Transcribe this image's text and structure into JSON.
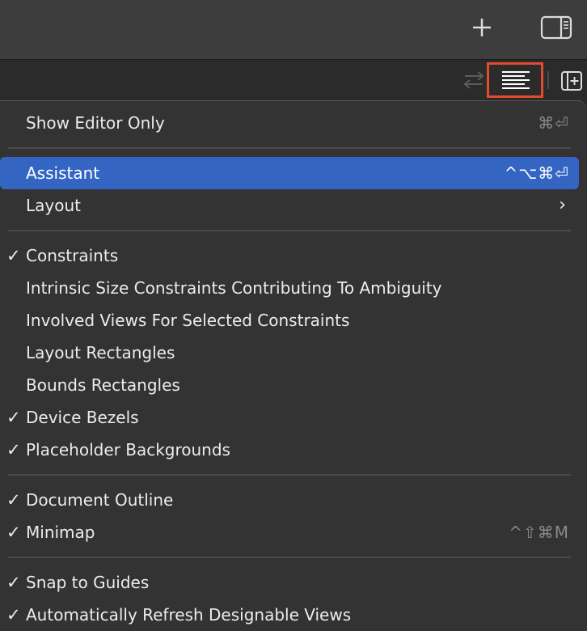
{
  "toolbar": {
    "plus_icon": "plus-icon",
    "inspector_icon": "inspector-toggle-icon"
  },
  "jumpbar": {
    "swap_icon": "swap-arrows-icon",
    "options_icon": "editor-options-icon",
    "add_editor_icon": "add-editor-icon",
    "highlight_color": "#e34b2c"
  },
  "menu": {
    "selected_color": "#3465c3",
    "items": [
      {
        "label": "Show Editor Only",
        "checked": false,
        "shortcut": "⌘⏎",
        "submenu": false
      },
      {
        "label": "Assistant",
        "checked": false,
        "shortcut": "^⌥⌘⏎",
        "submenu": false,
        "selected": true
      },
      {
        "label": "Layout",
        "checked": false,
        "shortcut": "",
        "submenu": true
      },
      {
        "label": "Constraints",
        "checked": true,
        "shortcut": "",
        "submenu": false
      },
      {
        "label": "Intrinsic Size Constraints Contributing To Ambiguity",
        "checked": false,
        "shortcut": "",
        "submenu": false
      },
      {
        "label": "Involved Views For Selected Constraints",
        "checked": false,
        "shortcut": "",
        "submenu": false
      },
      {
        "label": "Layout Rectangles",
        "checked": false,
        "shortcut": "",
        "submenu": false
      },
      {
        "label": "Bounds Rectangles",
        "checked": false,
        "shortcut": "",
        "submenu": false
      },
      {
        "label": "Device Bezels",
        "checked": true,
        "shortcut": "",
        "submenu": false
      },
      {
        "label": "Placeholder Backgrounds",
        "checked": true,
        "shortcut": "",
        "submenu": false
      },
      {
        "label": "Document Outline",
        "checked": true,
        "shortcut": "",
        "submenu": false
      },
      {
        "label": "Minimap",
        "checked": true,
        "shortcut": "^⇧⌘M",
        "submenu": false
      },
      {
        "label": "Snap to Guides",
        "checked": true,
        "shortcut": "",
        "submenu": false
      },
      {
        "label": "Automatically Refresh Designable Views",
        "checked": true,
        "shortcut": "",
        "submenu": false
      }
    ],
    "check_glyph": "✓",
    "chevron_glyph": "›"
  }
}
